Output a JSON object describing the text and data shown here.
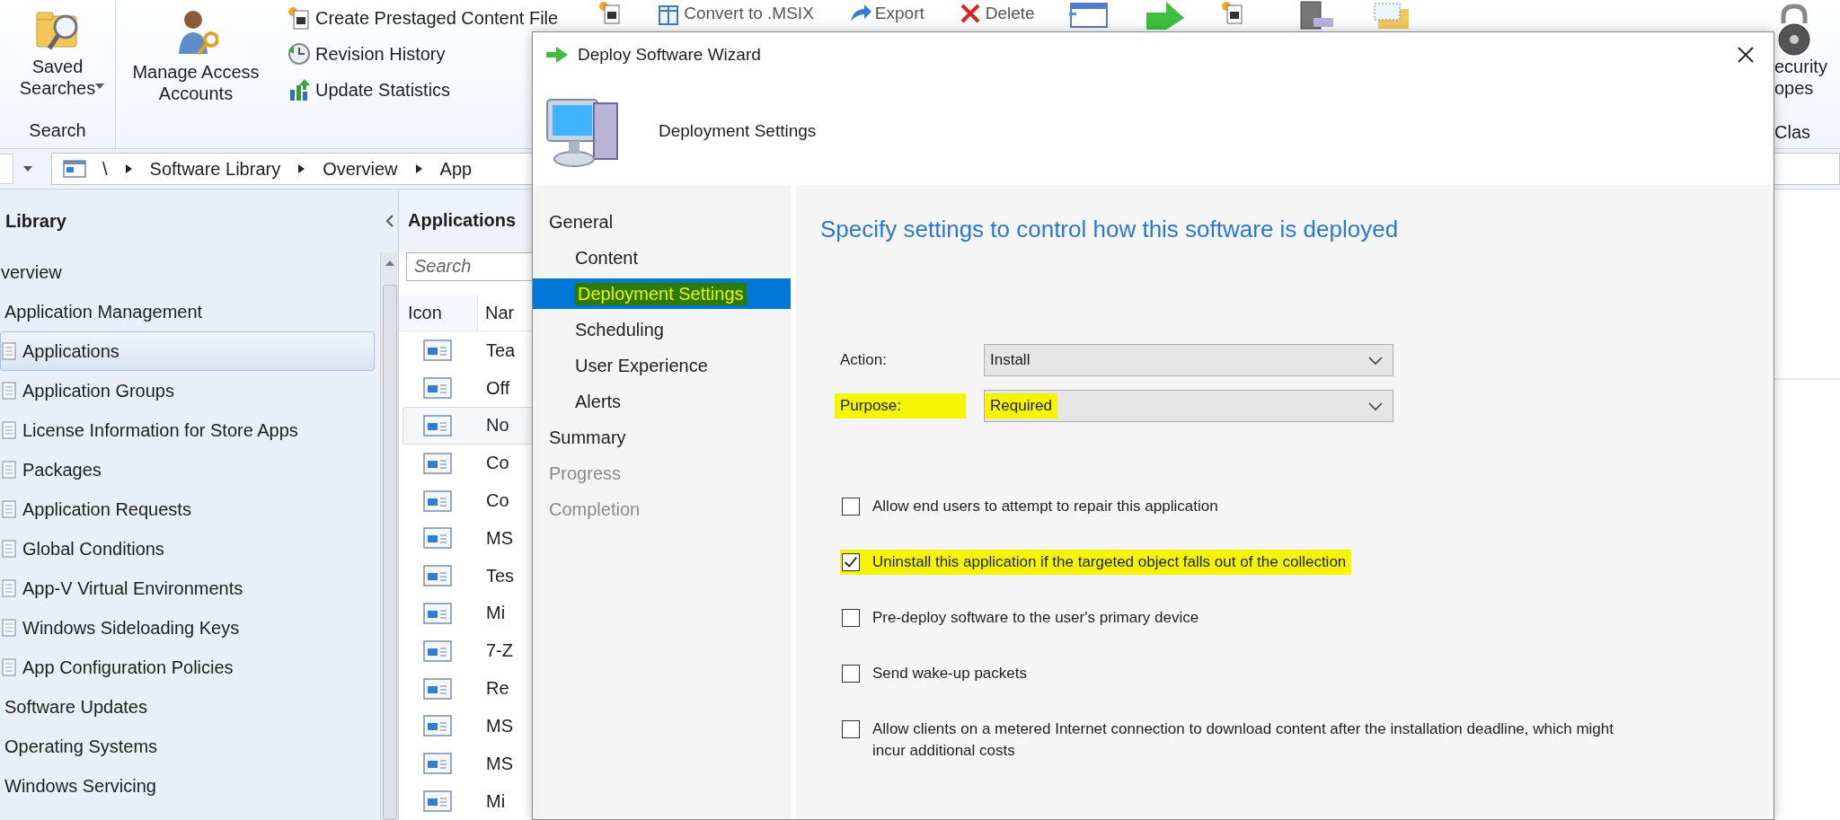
{
  "ribbon": {
    "saved_searches": "Saved Searches",
    "search_group": "Search",
    "manage_access": "Manage Access Accounts",
    "small_buttons": [
      "Create Prestaged Content File",
      "Revision History",
      "Update Statistics"
    ],
    "top_buttons": [
      "Convert to .MSIX",
      "Export",
      "Delete"
    ],
    "right_button_lines": [
      "ecurity",
      "opes"
    ],
    "right_group": "Clas"
  },
  "address_bar": {
    "segments": [
      "\\",
      "Software Library",
      "Overview",
      "App"
    ]
  },
  "navigation": {
    "title": "Library",
    "tree": [
      {
        "label": "verview",
        "selected": false,
        "children": [
          {
            "label": "Application Management",
            "selected": false,
            "children": [
              {
                "label": "Applications",
                "selected": true
              },
              {
                "label": "Application Groups",
                "selected": false
              },
              {
                "label": "License Information for Store Apps",
                "selected": false
              },
              {
                "label": "Packages",
                "selected": false
              },
              {
                "label": "Application Requests",
                "selected": false
              },
              {
                "label": "Global Conditions",
                "selected": false
              },
              {
                "label": "App-V Virtual Environments",
                "selected": false
              },
              {
                "label": "Windows Sideloading Keys",
                "selected": false
              },
              {
                "label": "App Configuration Policies",
                "selected": false
              }
            ]
          },
          {
            "label": "Software Updates",
            "selected": false
          },
          {
            "label": "Operating Systems",
            "selected": false
          },
          {
            "label": "Windows Servicing",
            "selected": false
          }
        ]
      }
    ]
  },
  "list": {
    "title": "Applications",
    "search_placeholder": "Search",
    "columns": [
      "Icon",
      "Nar"
    ],
    "rows": [
      {
        "name": "Tea",
        "selected": false
      },
      {
        "name": "Off",
        "selected": false
      },
      {
        "name": "No",
        "selected": true
      },
      {
        "name": "Co",
        "selected": false
      },
      {
        "name": "Co",
        "selected": false
      },
      {
        "name": "MS",
        "selected": false
      },
      {
        "name": "Tes",
        "selected": false
      },
      {
        "name": "Mi",
        "selected": false
      },
      {
        "name": "7-Z",
        "selected": false
      },
      {
        "name": "Re",
        "selected": false
      },
      {
        "name": "MS",
        "selected": false
      },
      {
        "name": "MS",
        "selected": false
      },
      {
        "name": "Mi",
        "selected": false
      }
    ]
  },
  "dialog": {
    "title": "Deploy Software Wizard",
    "page_title": "Deployment Settings",
    "steps": [
      {
        "label": "General",
        "selected": false,
        "disabled": false,
        "highlighted": false,
        "children": [
          {
            "label": "Content",
            "selected": false,
            "disabled": false,
            "highlighted": false
          },
          {
            "label": "Deployment Settings",
            "selected": true,
            "disabled": false,
            "highlighted": true
          },
          {
            "label": "Scheduling",
            "selected": false,
            "disabled": false,
            "highlighted": false
          },
          {
            "label": "User Experience",
            "selected": false,
            "disabled": false,
            "highlighted": false
          },
          {
            "label": "Alerts",
            "selected": false,
            "disabled": false,
            "highlighted": false
          }
        ]
      },
      {
        "label": "Summary",
        "selected": false,
        "disabled": false,
        "highlighted": false
      },
      {
        "label": "Progress",
        "selected": false,
        "disabled": true,
        "highlighted": false
      },
      {
        "label": "Completion",
        "selected": false,
        "disabled": true,
        "highlighted": false
      }
    ],
    "heading": "Specify settings to control how this software is deployed",
    "fields": [
      {
        "label": "Action:",
        "value": "Install",
        "highlighted": false
      },
      {
        "label": "Purpose:",
        "value": "Required",
        "highlighted": true
      }
    ],
    "options": [
      {
        "label": "Allow end users to attempt to repair this application",
        "checked": false,
        "highlighted": false
      },
      {
        "label": "Uninstall this application if the targeted object falls out of the collection",
        "checked": true,
        "highlighted": true
      },
      {
        "label": "Pre-deploy software to the user's primary device",
        "checked": false,
        "highlighted": false
      },
      {
        "label": "Send wake-up packets",
        "checked": false,
        "highlighted": false
      },
      {
        "label": "Allow clients on a metered Internet connection to download content after the installation deadline, which might incur additional costs",
        "checked": false,
        "highlighted": false
      }
    ]
  }
}
